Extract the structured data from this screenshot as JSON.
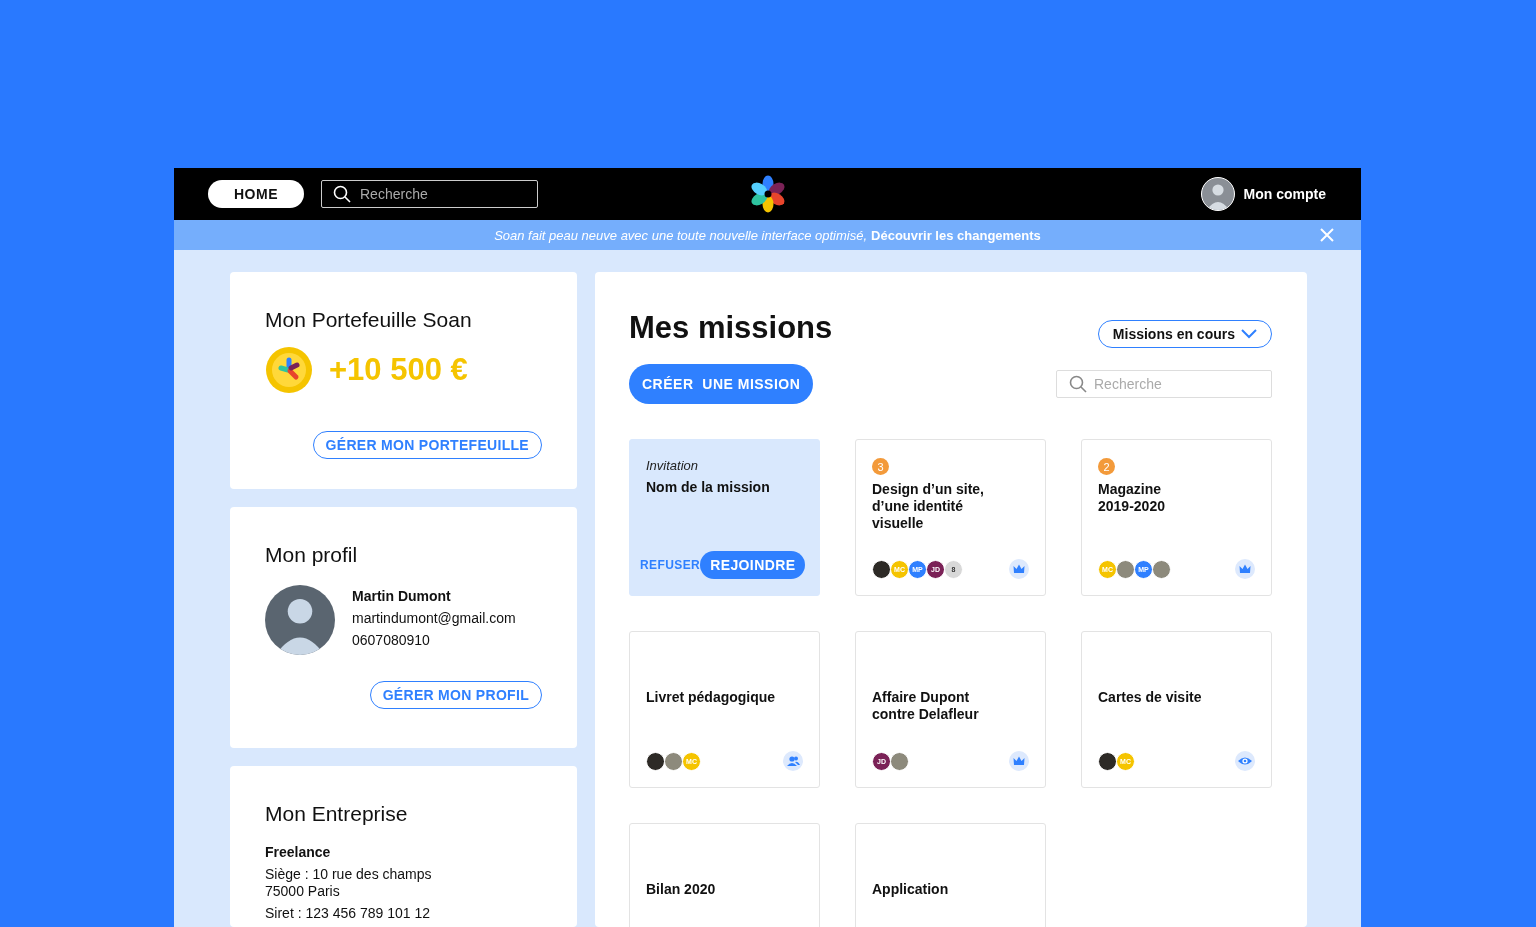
{
  "topbar": {
    "home_button": "HOME",
    "search": {
      "placeholder": "Recherche"
    },
    "account": {
      "label": "Mon compte"
    }
  },
  "banner": {
    "message": "Soan fait peau neuve avec une toute nouvelle interface optimisé,",
    "link": "Découvrir les changements"
  },
  "wallet": {
    "title": "Mon Portefeuille Soan",
    "amount": "+10 500 €",
    "button": "GÉRER MON PORTEFEUILLE"
  },
  "profile": {
    "title": "Mon profil",
    "name": "Martin Dumont",
    "email": "martindumont@gmail.com",
    "phone": "0607080910",
    "button": "GÉRER MON PROFIL"
  },
  "company": {
    "title": "Mon Entreprise",
    "type": "Freelance",
    "address_lines": [
      "Siège : 10 rue des champs",
      "75000 Paris"
    ],
    "siret": "Siret : 123 456 789 101 12"
  },
  "missions": {
    "title": "Mes missions",
    "filter": "Missions en cours",
    "create_button": "CRÉER  UNE MISSION",
    "search": {
      "placeholder": "Recherche"
    },
    "cards": [
      {
        "kind": "invitation",
        "label": "Invitation",
        "title_lines": [
          "Nom de la mission"
        ],
        "actions": [
          "REFUSER",
          "REJOINDRE"
        ]
      },
      {
        "kind": "mission",
        "badge": "3",
        "title_lines": [
          "Design d’un site,",
          "d’une identité",
          "visuelle"
        ],
        "members": [
          {
            "kind": "photo"
          },
          {
            "kind": "initials",
            "text": "MC",
            "color": "#f5c400"
          },
          {
            "kind": "initials",
            "text": "MP",
            "color": "#2f80ff"
          },
          {
            "kind": "initials",
            "text": "JD",
            "color": "#7b2257"
          },
          {
            "kind": "count",
            "text": "8"
          }
        ],
        "role": {
          "kind": "crown"
        }
      },
      {
        "kind": "mission",
        "badge": "2",
        "title_lines": [
          "Magazine",
          "2019-2020"
        ],
        "members": [
          {
            "kind": "initials",
            "text": "MC",
            "color": "#f5c400"
          },
          {
            "kind": "photo"
          },
          {
            "kind": "initials",
            "text": "MP",
            "color": "#2f80ff"
          },
          {
            "kind": "photo"
          }
        ],
        "role": {
          "kind": "crown"
        }
      },
      {
        "kind": "mission",
        "title_lines": [
          "Livret pédagogique"
        ],
        "members": [
          {
            "kind": "photo"
          },
          {
            "kind": "photo"
          },
          {
            "kind": "initials",
            "text": "MC",
            "color": "#f5c400"
          }
        ],
        "role": {
          "kind": "person"
        }
      },
      {
        "kind": "mission",
        "title_lines": [
          "Affaire Dupont",
          "contre  Delafleur"
        ],
        "members": [
          {
            "kind": "initials",
            "text": "JD",
            "color": "#7b2257"
          },
          {
            "kind": "photo"
          }
        ],
        "role": {
          "kind": "crown"
        }
      },
      {
        "kind": "mission",
        "title_lines": [
          "Cartes de visite"
        ],
        "members": [
          {
            "kind": "photo"
          },
          {
            "kind": "initials",
            "text": "MC",
            "color": "#f5c400"
          }
        ],
        "role": {
          "kind": "eye"
        }
      },
      {
        "kind": "mission",
        "title_lines": [
          "Bilan 2020"
        ]
      },
      {
        "kind": "mission",
        "title_lines": [
          "Application"
        ]
      }
    ]
  }
}
